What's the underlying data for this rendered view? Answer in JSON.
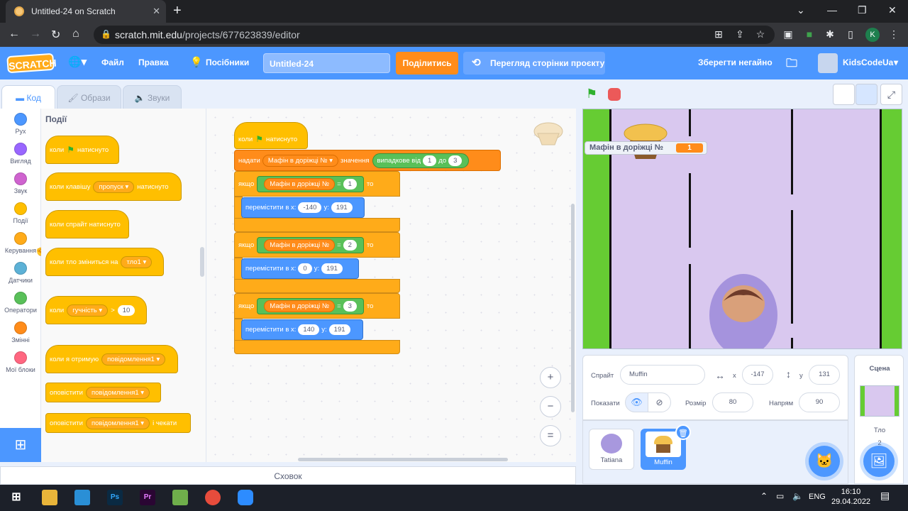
{
  "browser": {
    "tab_title": "Untitled-24 on Scratch",
    "url_host": "scratch.mit.edu",
    "url_path": "/projects/677623839/editor",
    "profile_initial": "K"
  },
  "menubar": {
    "logo": "SCRATCH",
    "file": "Файл",
    "edit": "Правка",
    "tutorials": "Посібники",
    "project_title": "Untitled-24",
    "share": "Поділитись",
    "see_project_page": "Перегляд сторінки проєкту",
    "save_now": "Зберегти негайно",
    "username": "KidsCodeUa"
  },
  "tabs": {
    "code": "Код",
    "costumes": "Образи",
    "sounds": "Звуки"
  },
  "categories": [
    {
      "label": "Рух",
      "color": "#4c97ff"
    },
    {
      "label": "Вигляд",
      "color": "#9966ff"
    },
    {
      "label": "Звук",
      "color": "#cf63cf"
    },
    {
      "label": "Події",
      "color": "#ffbf00"
    },
    {
      "label": "Керування",
      "color": "#ffab19"
    },
    {
      "label": "Датчики",
      "color": "#5cb1d6"
    },
    {
      "label": "Оператори",
      "color": "#59c059"
    },
    {
      "label": "Змінні",
      "color": "#ff8c1a"
    },
    {
      "label": "Мої блоки",
      "color": "#ff6680"
    }
  ],
  "palette": {
    "title": "Події",
    "when_flag": "коли",
    "when_flag_suffix": "натиснуто",
    "when_key": "коли клавішу",
    "key_option": "пропуск",
    "when_key_suffix": "натиснуто",
    "when_sprite_clicked": "коли спрайт натиснуто",
    "when_backdrop": "коли тло зміниться на",
    "backdrop_option": "тло1",
    "when_loudness": "коли",
    "loudness_option": "гучність",
    "gt": ">",
    "loudness_value": "10",
    "when_receive": "коли я отримую",
    "message1": "повідомлення1",
    "broadcast": "оповістити",
    "broadcast_wait": "оповістити",
    "and_wait": "і чекати"
  },
  "script": {
    "when_flag": "коли",
    "when_flag_suffix": "натиснуто",
    "set": "надати",
    "variable": "Мафін в доріжці №",
    "to": "значення",
    "random": "випадкове від",
    "random_from": "1",
    "random_to_label": "до",
    "random_to": "3",
    "if_label": "якщо",
    "then_label": "то",
    "eq": "=",
    "goto": "перемістити в x:",
    "y_label": "y:",
    "branches": [
      {
        "lane": "1",
        "x": "-140",
        "y": "191"
      },
      {
        "lane": "2",
        "x": "0",
        "y": "191"
      },
      {
        "lane": "3",
        "x": "140",
        "y": "191"
      }
    ]
  },
  "workspace": {
    "zoom_in": "+",
    "zoom_out": "−",
    "reset": "="
  },
  "backpack": "Сховок",
  "stage": {
    "monitor_label": "Мафін в доріжці №",
    "monitor_value": "1"
  },
  "sprite_info": {
    "sprite_label": "Спрайт",
    "sprite_name": "Muffin",
    "x_label": "x",
    "x_value": "-147",
    "y_label": "y",
    "y_value": "131",
    "show_label": "Показати",
    "size_label": "Розмір",
    "size_value": "80",
    "direction_label": "Напрям",
    "direction_value": "90"
  },
  "sprites": [
    {
      "name": "Tatiana"
    },
    {
      "name": "Muffin"
    }
  ],
  "stage_pane": {
    "title": "Сцена",
    "backdrops_label": "Тло",
    "backdrops_count": "2"
  },
  "taskbar": {
    "lang": "ENG",
    "time": "16:10",
    "date": "29.04.2022"
  }
}
